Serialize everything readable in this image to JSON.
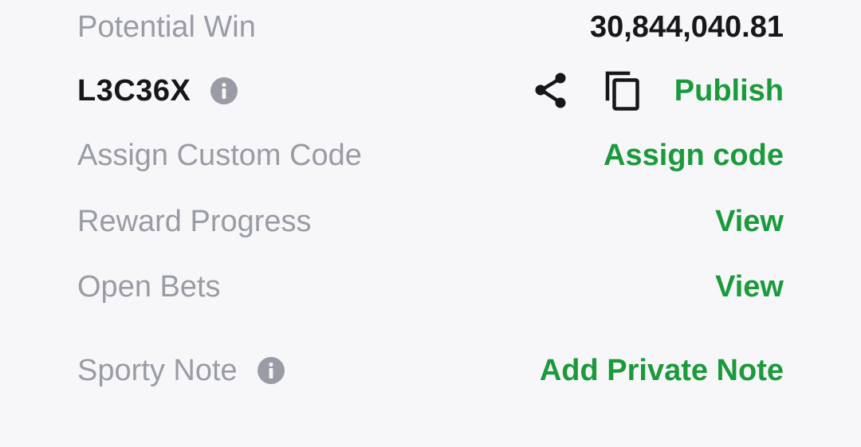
{
  "potential_win": {
    "label": "Potential Win",
    "value": "30,844,040.81"
  },
  "booking": {
    "code": "L3C36X",
    "info_icon": "info-icon",
    "share_icon": "share-icon",
    "copy_icon": "copy-icon",
    "publish_label": "Publish"
  },
  "custom_code": {
    "label": "Assign Custom Code",
    "action": "Assign code"
  },
  "reward_progress": {
    "label": "Reward Progress",
    "action": "View"
  },
  "open_bets": {
    "label": "Open Bets",
    "action": "View"
  },
  "sporty_note": {
    "label": "Sporty Note",
    "info_icon": "info-icon",
    "action": "Add Private Note"
  },
  "colors": {
    "background": "#f7f7f9",
    "label_gray": "#9a9ca5",
    "text_dark": "#16171b",
    "action_green": "#1b9a3c"
  }
}
